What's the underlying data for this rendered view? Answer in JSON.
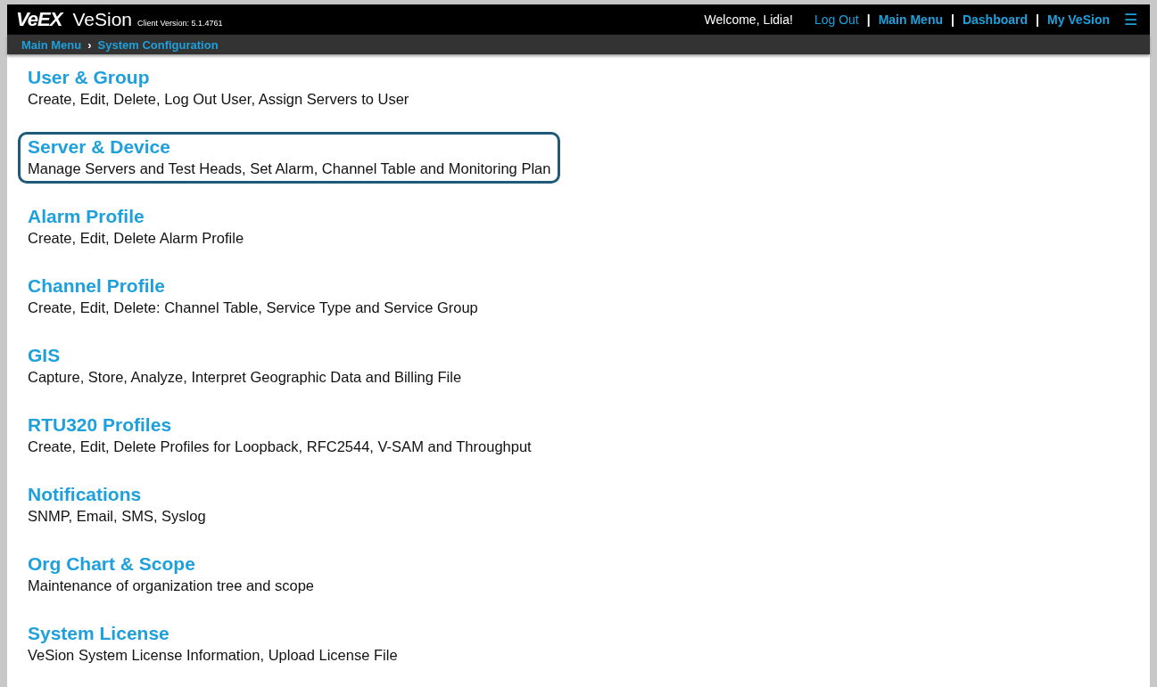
{
  "header": {
    "logo": "VeEX",
    "app_name": "VeSion",
    "version": "Client Version: 5.1.4761",
    "welcome": "Welcome, Lidia!",
    "links": [
      {
        "label": "Log Out",
        "bold": false
      },
      {
        "label": "Main Menu",
        "bold": true
      },
      {
        "label": "Dashboard",
        "bold": true
      },
      {
        "label": "My VeSion",
        "bold": true
      }
    ],
    "separator": "|",
    "menu_icon": "☰"
  },
  "breadcrumb": {
    "items": [
      "Main Menu",
      "System Configuration"
    ],
    "separator": "›"
  },
  "sections": [
    {
      "title": "User & Group",
      "description": "Create, Edit, Delete, Log Out User, Assign Servers to User",
      "highlighted": false
    },
    {
      "title": "Server & Device",
      "description": "Manage Servers and Test Heads, Set Alarm, Channel Table and Monitoring Plan",
      "highlighted": true
    },
    {
      "title": "Alarm Profile",
      "description": "Create, Edit, Delete Alarm Profile",
      "highlighted": false
    },
    {
      "title": "Channel Profile",
      "description": "Create, Edit, Delete: Channel Table, Service Type and Service Group",
      "highlighted": false
    },
    {
      "title": "GIS",
      "description": "Capture, Store, Analyze, Interpret Geographic Data and Billing File",
      "highlighted": false
    },
    {
      "title": "RTU320 Profiles",
      "description": "Create, Edit, Delete Profiles for Loopback, RFC2544, V-SAM and Throughput",
      "highlighted": false
    },
    {
      "title": "Notifications",
      "description": "SNMP, Email, SMS, Syslog",
      "highlighted": false
    },
    {
      "title": "Org Chart & Scope",
      "description": "Maintenance of organization tree and scope",
      "highlighted": false
    },
    {
      "title": "System License",
      "description": "VeSion System License Information, Upload License File",
      "highlighted": false
    }
  ]
}
